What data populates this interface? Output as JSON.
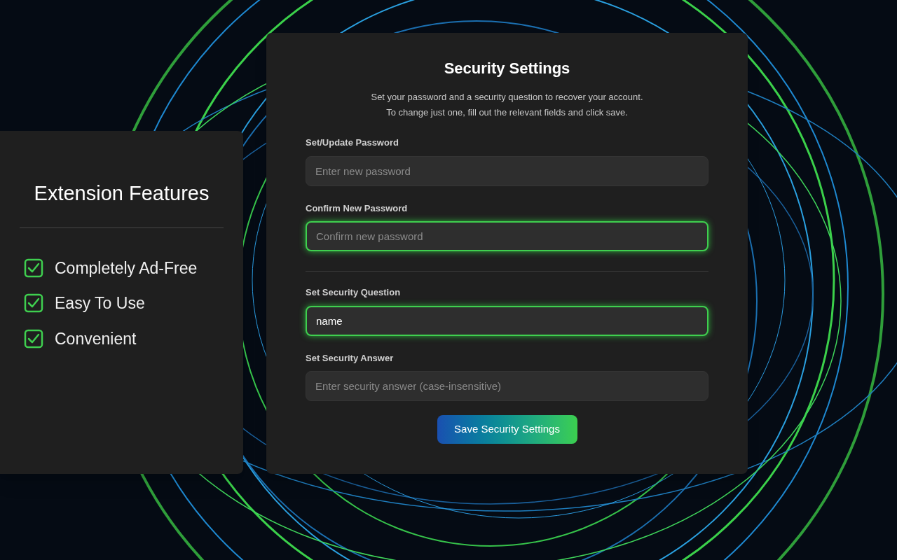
{
  "features_panel": {
    "title": "Extension Features",
    "items": [
      {
        "label": "Completely Ad-Free",
        "checked": true
      },
      {
        "label": "Easy To Use",
        "checked": true
      },
      {
        "label": "Convenient",
        "checked": true
      }
    ]
  },
  "settings_panel": {
    "title": "Security Settings",
    "description_lines": [
      "Set your password and a security question to recover your account.",
      "To change just one, fill out the relevant fields and click save."
    ],
    "sections": [
      {
        "fields": [
          {
            "label": "Set/Update Password",
            "placeholder": "Enter new password",
            "highlighted": false
          },
          {
            "label": "Confirm New Password",
            "placeholder": "Confirm new password",
            "highlighted": true
          }
        ]
      },
      {
        "fields": [
          {
            "label": "Set Security Question",
            "value": "name",
            "highlighted": true
          },
          {
            "label": "Set Security Answer",
            "placeholder": "Enter security answer (case-insensitive)",
            "highlighted": false
          }
        ]
      }
    ],
    "save_button": "Save Security Settings"
  }
}
